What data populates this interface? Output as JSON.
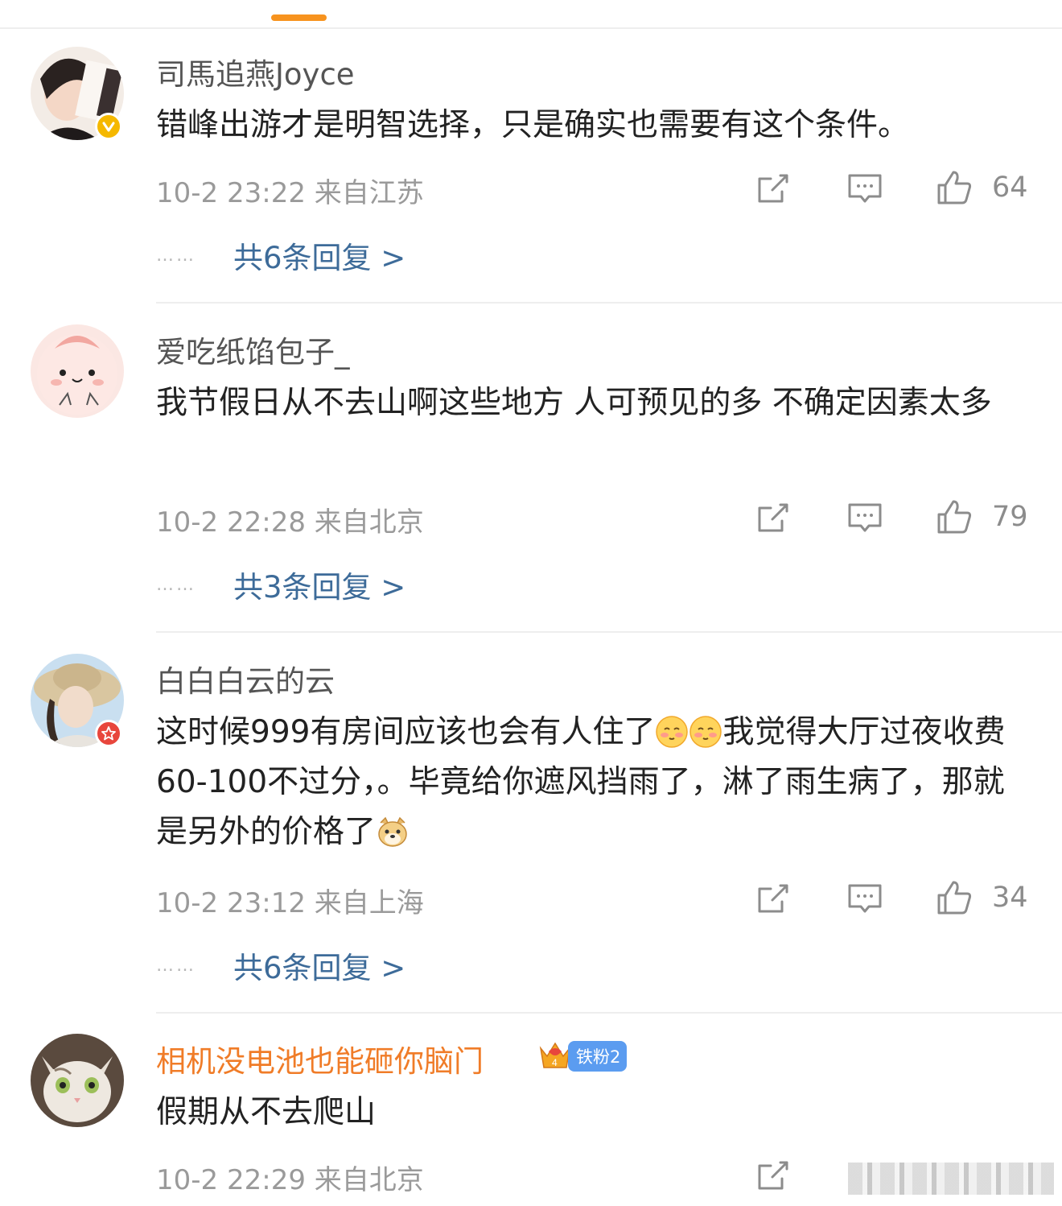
{
  "comments": [
    {
      "username": "司馬追燕Joyce",
      "text": "错峰出游才是明智选择，只是确实也需要有这个条件。",
      "time": "10-2 23:22",
      "location": "来自江苏",
      "likes": "64",
      "replies": "共6条回复 >",
      "badge": "verified-yellow"
    },
    {
      "username": "爱吃纸馅包子_",
      "text": "我节假日从不去山啊这些地方 人可预见的多 不确定因素太多",
      "time": "10-2 22:28",
      "location": "来自北京",
      "likes": "79",
      "replies": "共3条回复 >"
    },
    {
      "username": "白白白云的云",
      "text_part1": "这时候999有房间应该也会有人住了",
      "text_part2": "我觉得大厅过夜收费60-100不过分，。毕竟给你遮风挡雨了，淋了雨生病了，那就是另外的价格了",
      "time": "10-2 23:12",
      "location": "来自上海",
      "likes": "34",
      "replies": "共6条回复 >",
      "badge": "star-red"
    },
    {
      "username": "相机没电池也能砸你脑门",
      "fan_level": "铁粉2",
      "text": "假期从不去爬山",
      "time": "10-2 22:29",
      "location": "来自北京"
    }
  ],
  "dots": "……",
  "colors": {
    "accent": "#f7931e",
    "link": "#3d6b99",
    "vip_name": "#f07c28",
    "verified": "#f5b800",
    "star_badge": "#e8463c",
    "fan_pill": "#5b9cf0"
  },
  "icons": [
    "share-icon",
    "comment-icon",
    "like-icon",
    "verified-badge-icon",
    "star-badge-icon",
    "crown-icon"
  ]
}
